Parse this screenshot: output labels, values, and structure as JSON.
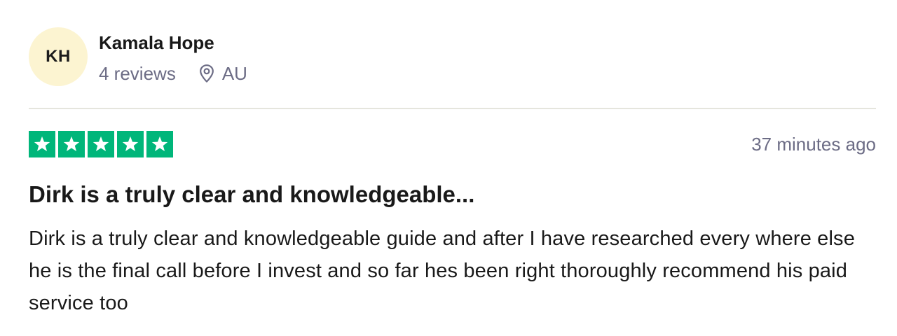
{
  "consumer": {
    "initials": "KH",
    "name": "Kamala Hope",
    "reviews_count": "4 reviews",
    "location_icon": "location-pin-icon",
    "country": "AU",
    "avatar_color": "#fcf4d1"
  },
  "review": {
    "rating": 5,
    "rating_max": 5,
    "star_icon": "star-icon",
    "star_color": "#00b67a",
    "date": "37 minutes ago",
    "title": "Dirk is a truly clear and knowledgeable...",
    "body": "Dirk is a truly clear and knowledgeable guide and after I have researched every where else he is the final call before I invest and so far hes been right thoroughly recommend his paid service too"
  }
}
